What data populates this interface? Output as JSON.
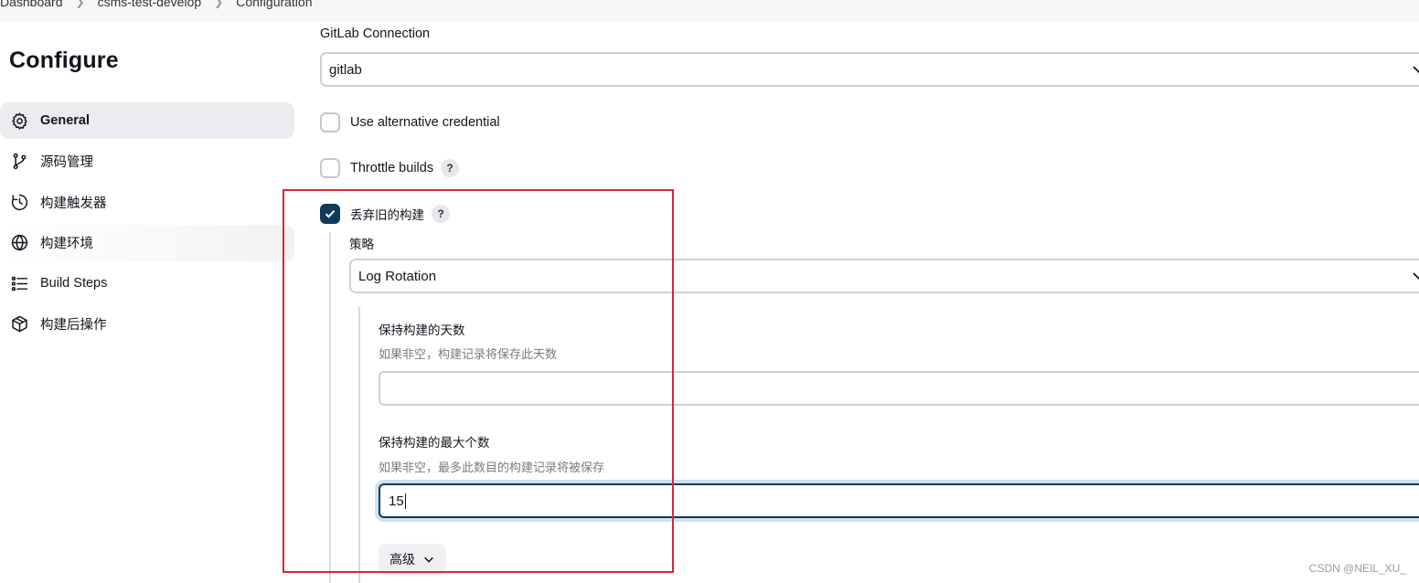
{
  "breadcrumb": [
    "Dashboard",
    "csms-test-develop",
    "Configuration"
  ],
  "page_title": "Configure",
  "sidebar": {
    "items": [
      {
        "label": "General",
        "icon": "gear-icon",
        "active": true
      },
      {
        "label": "源码管理",
        "icon": "branch-icon"
      },
      {
        "label": "构建触发器",
        "icon": "clock-icon"
      },
      {
        "label": "构建环境",
        "icon": "globe-icon"
      },
      {
        "label": "Build Steps",
        "icon": "list-icon"
      },
      {
        "label": "构建后操作",
        "icon": "package-icon"
      }
    ]
  },
  "form": {
    "gitlab_connection": {
      "label": "GitLab Connection",
      "value": "gitlab"
    },
    "use_alt_credential": {
      "label": "Use alternative credential",
      "checked": false
    },
    "throttle_builds": {
      "label": "Throttle builds",
      "checked": false,
      "help": "?"
    },
    "discard_old_builds": {
      "label": "丢弃旧的构建",
      "checked": true,
      "help": "?"
    },
    "strategy": {
      "label": "策略",
      "value": "Log Rotation"
    },
    "days_to_keep": {
      "title": "保持构建的天数",
      "description": "如果非空，构建记录将保存此天数",
      "value": ""
    },
    "max_builds": {
      "title": "保持构建的最大个数",
      "description": "如果非空，最多此数目的构建记录将被保存",
      "value": "15"
    },
    "advanced_label": "高级"
  },
  "colors": {
    "accent": "#0e3a5c",
    "highlight_box": "#d42a35"
  },
  "watermark": "CSDN @NEIL_XU_"
}
